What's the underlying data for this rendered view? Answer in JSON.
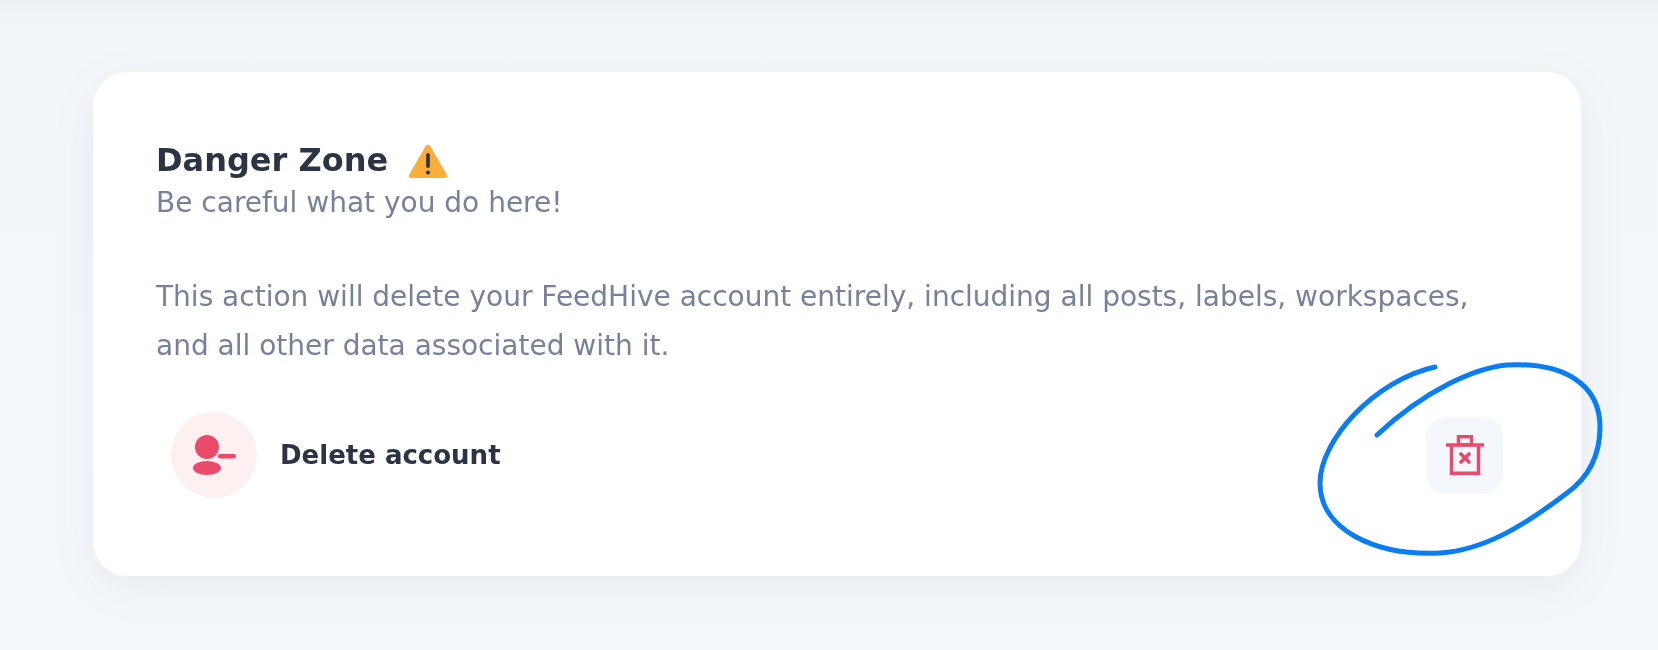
{
  "section": {
    "title": "Danger Zone",
    "subtitle": "Be careful what you do here!",
    "description": "This action will delete your FeedHive account entirely, including all posts, labels, workspaces, and all other data associated with it."
  },
  "action": {
    "label": "Delete account"
  }
}
